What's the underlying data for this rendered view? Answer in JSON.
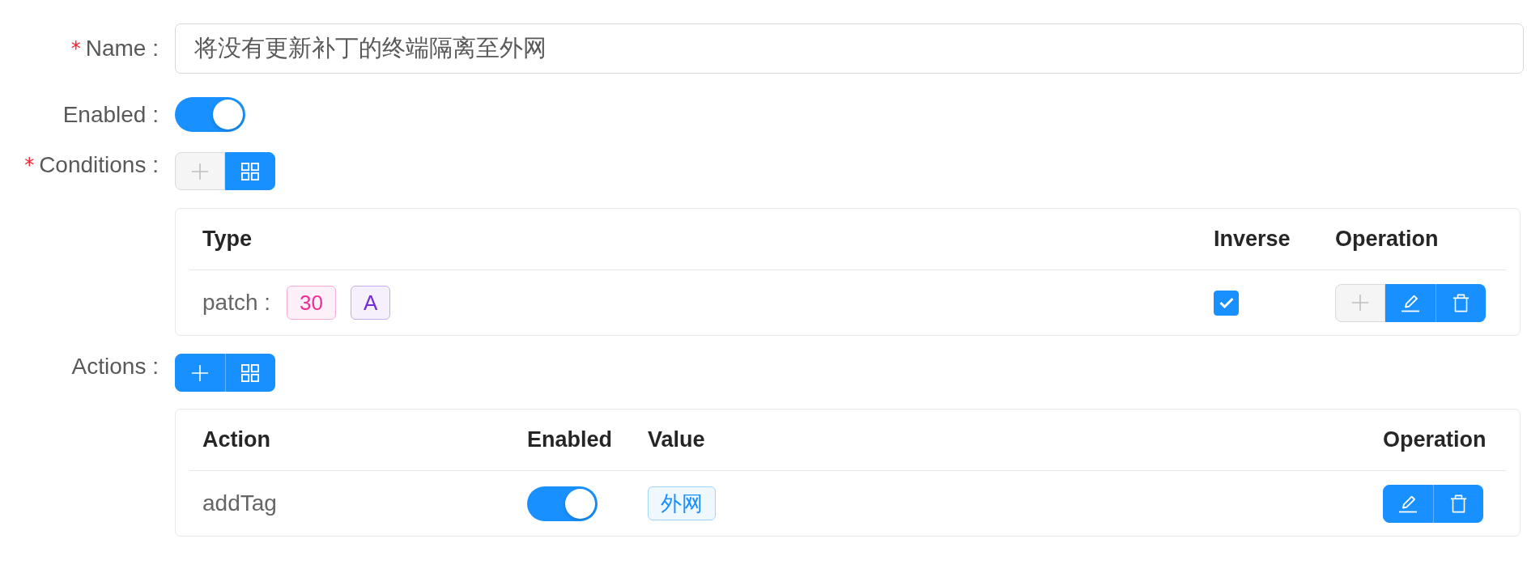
{
  "name": {
    "label": "Name :",
    "required_mark": "*",
    "value": "将没有更新补丁的终端隔离至外网"
  },
  "enabled": {
    "label": "Enabled :",
    "on": true
  },
  "conditions": {
    "label": "Conditions :",
    "required_mark": "*",
    "toolbar": [
      {
        "kind": "add",
        "disabled": true
      },
      {
        "kind": "grid",
        "disabled": false
      }
    ],
    "table": {
      "columns": [
        "Type",
        "Inverse",
        "Operation"
      ],
      "rows": [
        {
          "type_label": "patch :",
          "tags": [
            {
              "text": "30",
              "color": "#eb2f96"
            },
            {
              "text": "A",
              "color": "#722ed1"
            }
          ],
          "inverse": {
            "checked": true
          },
          "operations": [
            {
              "kind": "add",
              "disabled": true
            },
            {
              "kind": "edit",
              "disabled": false
            },
            {
              "kind": "delete",
              "disabled": false
            }
          ]
        }
      ]
    }
  },
  "actions": {
    "label": "Actions :",
    "toolbar": [
      {
        "kind": "add",
        "disabled": false
      },
      {
        "kind": "grid",
        "disabled": false
      }
    ],
    "table": {
      "columns": [
        "Action",
        "Enabled",
        "Value",
        "Operation"
      ],
      "rows": [
        {
          "action": "addTag",
          "enabled": {
            "on": true
          },
          "value_tags": [
            {
              "text": "外网",
              "color": "#1890ff"
            }
          ],
          "operations": [
            {
              "kind": "edit",
              "disabled": false
            },
            {
              "kind": "delete",
              "disabled": false
            }
          ]
        }
      ]
    }
  }
}
